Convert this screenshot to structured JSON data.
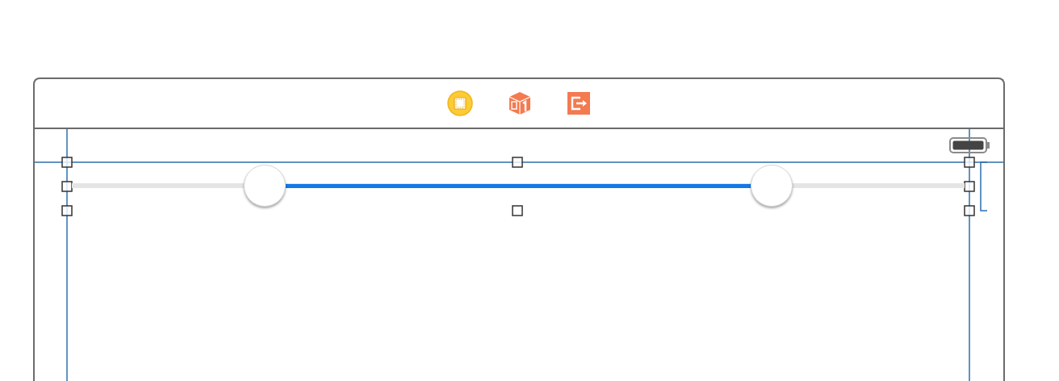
{
  "range_slider": {
    "thumbs": [
      {
        "level": 0.216
      },
      {
        "level": 0.784
      }
    ]
  }
}
